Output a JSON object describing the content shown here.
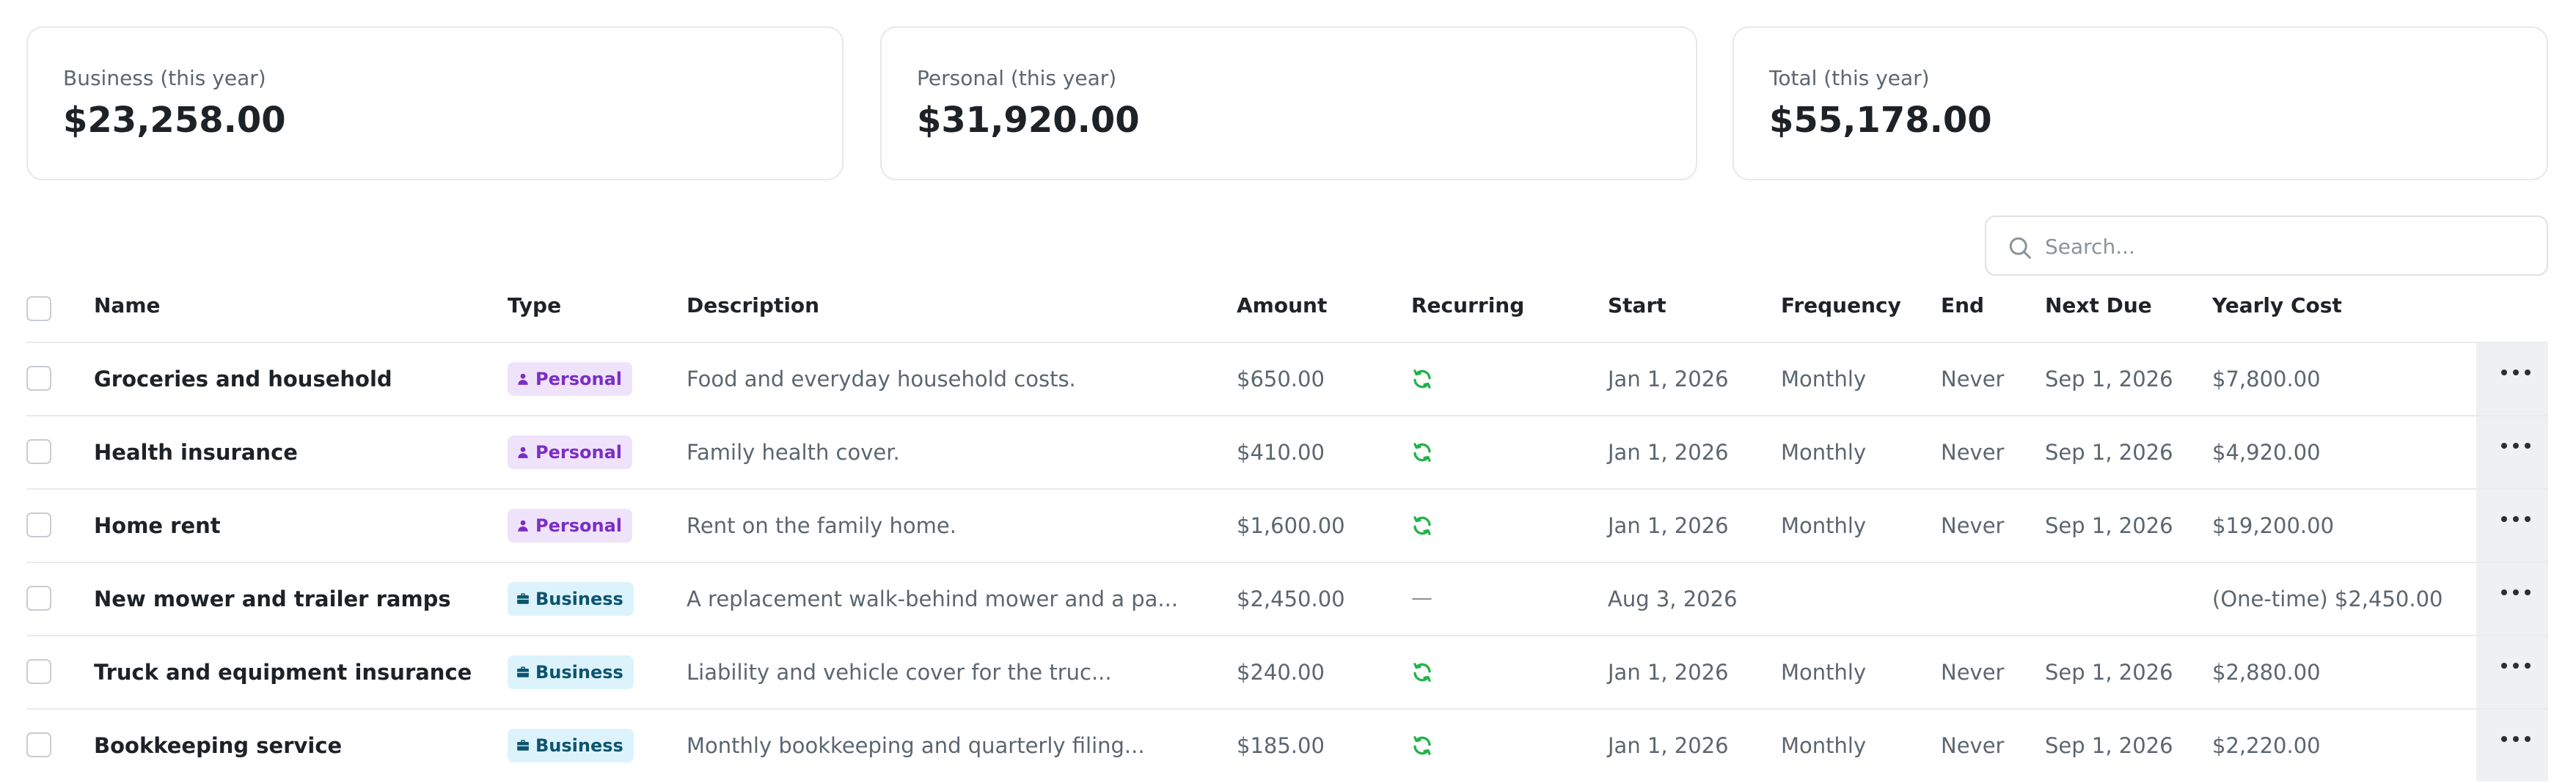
{
  "summary": [
    {
      "label": "Business (this year)",
      "value": "$23,258.00"
    },
    {
      "label": "Personal (this year)",
      "value": "$31,920.00"
    },
    {
      "label": "Total (this year)",
      "value": "$55,178.00"
    }
  ],
  "search": {
    "placeholder": "Search..."
  },
  "columns": {
    "name": "Name",
    "type": "Type",
    "description": "Description",
    "amount": "Amount",
    "recurring": "Recurring",
    "start": "Start",
    "frequency": "Frequency",
    "end": "End",
    "next_due": "Next Due",
    "yearly_cost": "Yearly Cost"
  },
  "rows": [
    {
      "name": "Groceries and household",
      "type": "Personal",
      "description": "Food and everyday household costs.",
      "amount": "$650.00",
      "recurring": true,
      "start": "Jan 1, 2026",
      "frequency": "Monthly",
      "end": "Never",
      "next_due": "Sep 1, 2026",
      "yearly_cost": "$7,800.00"
    },
    {
      "name": "Health insurance",
      "type": "Personal",
      "description": "Family health cover.",
      "amount": "$410.00",
      "recurring": true,
      "start": "Jan 1, 2026",
      "frequency": "Monthly",
      "end": "Never",
      "next_due": "Sep 1, 2026",
      "yearly_cost": "$4,920.00"
    },
    {
      "name": "Home rent",
      "type": "Personal",
      "description": "Rent on the family home.",
      "amount": "$1,600.00",
      "recurring": true,
      "start": "Jan 1, 2026",
      "frequency": "Monthly",
      "end": "Never",
      "next_due": "Sep 1, 2026",
      "yearly_cost": "$19,200.00"
    },
    {
      "name": "New mower and trailer ramps",
      "type": "Business",
      "description": "A replacement walk-behind mower and a pa...",
      "amount": "$2,450.00",
      "recurring": false,
      "recurring_text": "—",
      "start": "Aug 3, 2026",
      "frequency": "",
      "end": "",
      "next_due": "",
      "yearly_cost": "(One-time) $2,450.00"
    },
    {
      "name": "Truck and equipment insurance",
      "type": "Business",
      "description": "Liability and vehicle cover for the truc...",
      "amount": "$240.00",
      "recurring": true,
      "start": "Jan 1, 2026",
      "frequency": "Monthly",
      "end": "Never",
      "next_due": "Sep 1, 2026",
      "yearly_cost": "$2,880.00"
    },
    {
      "name": "Bookkeeping service",
      "type": "Business",
      "description": "Monthly bookkeeping and quarterly filing...",
      "amount": "$185.00",
      "recurring": true,
      "start": "Jan 1, 2026",
      "frequency": "Monthly",
      "end": "Never",
      "next_due": "Sep 1, 2026",
      "yearly_cost": "$2,220.00"
    }
  ],
  "icons": {
    "search": "search-icon",
    "recurring": "refresh-icon",
    "personal": "person-icon",
    "business": "briefcase-icon",
    "actions": "more-horizontal-icon"
  },
  "colors": {
    "personal_badge_bg": "#efe3fb",
    "personal_badge_text": "#7b2ec4",
    "business_badge_bg": "#dcf3fb",
    "business_badge_text": "#0c5470",
    "recurring_icon": "#22b34a"
  }
}
